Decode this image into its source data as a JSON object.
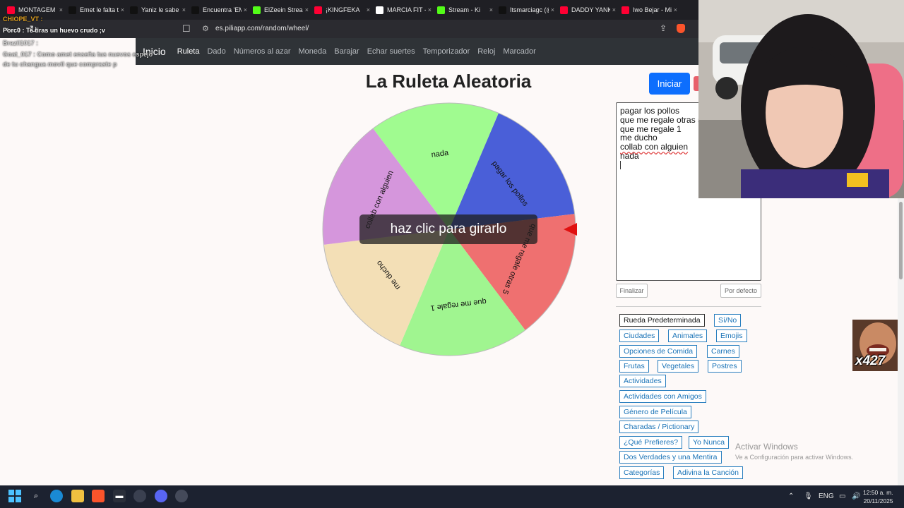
{
  "browser": {
    "tabs": [
      {
        "label": "MONTAGEM FU",
        "icon": "youtube-icon",
        "color": "#ff0033"
      },
      {
        "label": "Emet le falta tra",
        "icon": "tiktok-icon",
        "color": "#111111"
      },
      {
        "label": "Yaniz le sabe a",
        "icon": "tiktok-icon",
        "color": "#111111"
      },
      {
        "label": "Encuentra 'EME",
        "icon": "tiktok-icon",
        "color": "#111111"
      },
      {
        "label": "ElZeein Stream",
        "icon": "kick-icon",
        "color": "#53fc18"
      },
      {
        "label": "¡KINGFEKA",
        "icon": "youtube-icon",
        "color": "#ff0033"
      },
      {
        "label": "MARCIA FIT - B",
        "icon": "google-icon",
        "color": "#ffffff"
      },
      {
        "label": "Stream - Ki",
        "icon": "kick-icon",
        "color": "#53fc18"
      },
      {
        "label": "Itsmarciagc (@",
        "icon": "tiktok-icon",
        "color": "#111111"
      },
      {
        "label": "DADDY YANKE",
        "icon": "youtube-icon",
        "color": "#ff0033"
      },
      {
        "label": "Iwo Bejar - Mim",
        "icon": "youtube-icon",
        "color": "#ff0033"
      }
    ],
    "url": "es.piliapp.com/random/wheel/"
  },
  "chat": {
    "lines": [
      {
        "text": "CHIOPE_VT :",
        "color": "#e0a020"
      },
      {
        "text": "Porc0 : Te tiras un huevo crudo ;v",
        "color": "#ffffff"
      },
      {
        "text": "Brazil1017 :",
        "color": "#d0d0d0"
      },
      {
        "text": "Goat_017 : Como amet enseña tus nuevos espejo",
        "color": "#c8c8c8"
      },
      {
        "text": "de tu changua movil que compraste p",
        "color": "#c8c8c8"
      }
    ]
  },
  "nav": {
    "brand": "Inicio",
    "items": [
      "Ruleta",
      "Dado",
      "Números al azar",
      "Moneda",
      "Barajar",
      "Echar suertes",
      "Temporizador",
      "Reloj",
      "Marcador"
    ]
  },
  "page": {
    "title": "La Ruleta Aleatoria",
    "start_label": "Iniciar",
    "spin_label": "haz clic para girarlo",
    "entries": [
      "pagar los pollos",
      "que me regale otras 5",
      "que me regale 1",
      "me ducho",
      "collab con alguien",
      "nada"
    ],
    "finish_label": "Finalizar",
    "default_label": "Por defecto",
    "presets": [
      "Rueda Predeterminada",
      "Sí/No",
      "Ciudades",
      "Animales",
      "Emojis",
      "Opciones de Comida",
      "Carnes",
      "Frutas",
      "Vegetales",
      "Postres",
      "Actividades",
      "Actividades con Amigos",
      "Género de Película",
      "Charadas / Pictionary",
      "¿Qué Prefieres?",
      "Yo Nunca",
      "Dos Verdades y una Mentira",
      "Categorías",
      "Adivina la Canción"
    ]
  },
  "wheel_colors": {
    "pagar los pollos": "#4a5fd8",
    "que me regale otras 5": "#ef7070",
    "que me regale 1": "#a0f590",
    "me ducho": "#f3dfb6",
    "collab con alguien": "#d596dc",
    "nada": "#a0fb90",
    "pointer": "#e01010"
  },
  "overlay": {
    "emote_label": "x427",
    "activate_title": "Activar Windows",
    "activate_sub": "Ve a Configuración para activar Windows."
  },
  "taskbar": {
    "lang": "ENG",
    "time": "12:50 a. m.",
    "date": "20/11/2025"
  }
}
